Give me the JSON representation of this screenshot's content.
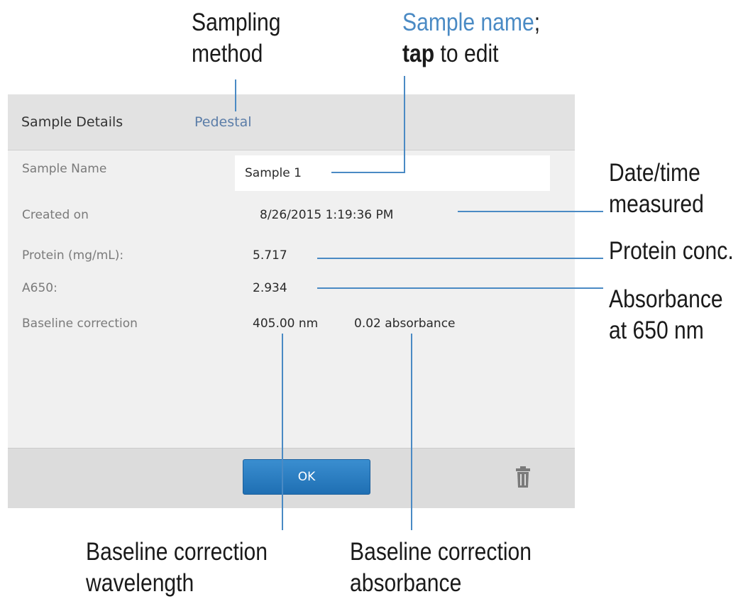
{
  "annotations": {
    "sampling_method": [
      "Sampling",
      "method"
    ],
    "sample_name": {
      "line1_accent": "Sample name",
      "line1_suffix": ";",
      "line2_bold": "tap",
      "line2_rest": " to edit"
    },
    "date_time": [
      "Date/time",
      "measured"
    ],
    "protein_conc": "Protein conc.",
    "absorbance": [
      "Absorbance",
      "at 650 nm"
    ],
    "baseline_wavelength": [
      "Baseline correction",
      "wavelength"
    ],
    "baseline_absorbance": [
      "Baseline correction",
      "absorbance"
    ]
  },
  "dialog": {
    "title": "Sample Details",
    "method": "Pedestal",
    "rows": {
      "sample_name": {
        "label": "Sample Name",
        "value": "Sample 1"
      },
      "created_on": {
        "label": "Created on",
        "value": "8/26/2015 1:19:36 PM"
      },
      "protein": {
        "label": "Protein (mg/mL):",
        "value": "5.717"
      },
      "a650": {
        "label": "A650:",
        "value": "2.934"
      },
      "baseline": {
        "label": "Baseline correction",
        "wavelength": "405.00 nm",
        "absorbance": "0.02 absorbance"
      }
    },
    "ok_label": "OK",
    "delete_icon": "trash-icon"
  },
  "colors": {
    "accent": "#4a8ac4",
    "ok_button": "#2a7fc4",
    "header_bg": "#e2e2e2",
    "body_bg": "#f0f0f0",
    "footer_bg": "#dcdcdc"
  }
}
